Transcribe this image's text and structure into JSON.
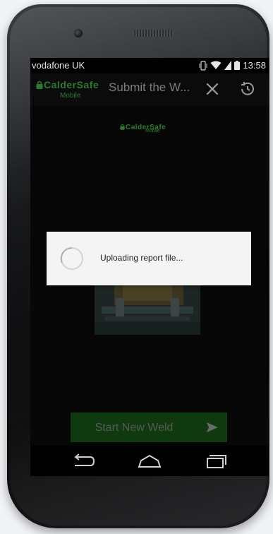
{
  "status_bar": {
    "carrier": "vodafone UK",
    "time": "13:58",
    "icons": [
      "vibrate-icon",
      "wifi-icon",
      "signal-icon",
      "battery-icon"
    ]
  },
  "action_bar": {
    "logo_text": "CalderSafe",
    "logo_sub": "Mobile",
    "title": "Submit the W...",
    "icons": [
      "tools-icon",
      "history-icon"
    ]
  },
  "content": {
    "logo_text": "CalderSafe",
    "logo_sub": "Mobile"
  },
  "dialog": {
    "message": "Uploading report file..."
  },
  "start_button": {
    "label": "Start New Weld",
    "icon": "send-icon"
  },
  "nav_bar": {
    "icons": [
      "back-icon",
      "home-icon",
      "recent-apps-icon"
    ]
  },
  "colors": {
    "brand_green": "#2b7d2b",
    "button_green": "#0f3a0f",
    "screen_dim": "#070707",
    "dialog_bg": "#f4f4f4"
  }
}
